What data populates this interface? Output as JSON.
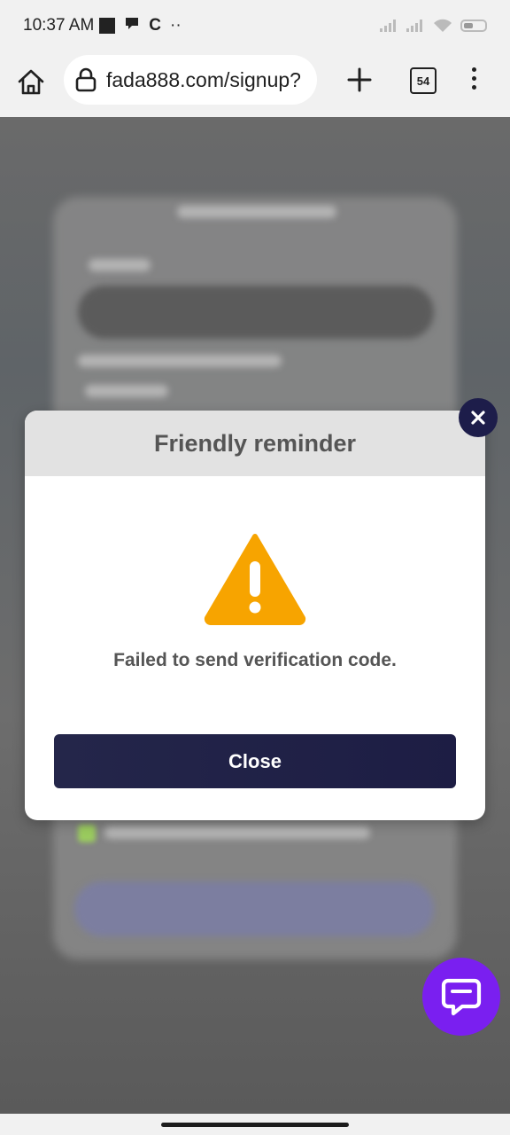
{
  "status_bar": {
    "time": "10:37 AM",
    "glyph_c": "C",
    "glyph_dots": "··"
  },
  "browser": {
    "url": "fada888.com/signup?",
    "tab_count": "54"
  },
  "dialog": {
    "title": "Friendly reminder",
    "message": "Failed to send verification code.",
    "close_label": "Close",
    "icon": "warning-icon",
    "warning_color": "#f7a400",
    "button_color": "#1f2048"
  },
  "chat": {
    "icon": "chat-icon",
    "color": "#7a1ff0"
  }
}
